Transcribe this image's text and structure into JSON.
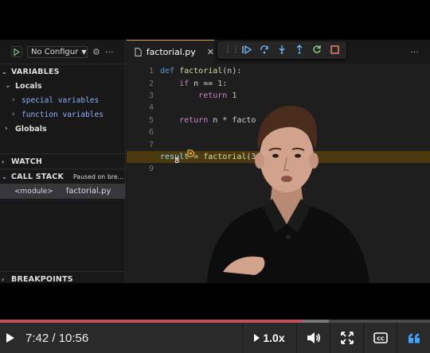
{
  "debug_sidebar": {
    "run_config_label": "No Configur",
    "sections": {
      "variables": "VARIABLES",
      "locals": "Locals",
      "special_variables": "special variables",
      "function_variables": "function variables",
      "globals": "Globals",
      "watch": "WATCH",
      "call_stack": "CALL STACK",
      "paused_status": "Paused on bre...",
      "breakpoints": "BREAKPOINTS"
    },
    "call_stack_frame": {
      "name": "<module>",
      "file": "factorial.py"
    }
  },
  "editor": {
    "tab_title": "factorial.py",
    "current_line": 8,
    "lines": [
      {
        "num": "1"
      },
      {
        "num": "2"
      },
      {
        "num": "3"
      },
      {
        "num": "4"
      },
      {
        "num": "5"
      },
      {
        "num": "6"
      },
      {
        "num": "7"
      },
      {
        "num": "8"
      },
      {
        "num": "9"
      }
    ],
    "code": {
      "l1_kw": "def",
      "l1_fn": "factorial",
      "l1_rest": "(n):",
      "l2_kw": "if",
      "l2_rest": "n == ",
      "l2_num": "1",
      "l2_colon": ":",
      "l3_kw": "return",
      "l3_num": "1",
      "l5_kw": "return",
      "l5_rest": "n * facto",
      "l8_var": "result",
      "l8_eq": " = ",
      "l8_fn": "factorial",
      "l8_rest": "(3"
    }
  },
  "player": {
    "time_display": "7:42 / 10:56",
    "progress_fraction": 0.704,
    "buffered_fraction": 0.06,
    "speed_label": "1.0x",
    "colors": {
      "progress": "#c0505a",
      "accent_blue": "#3ea6ff"
    }
  }
}
